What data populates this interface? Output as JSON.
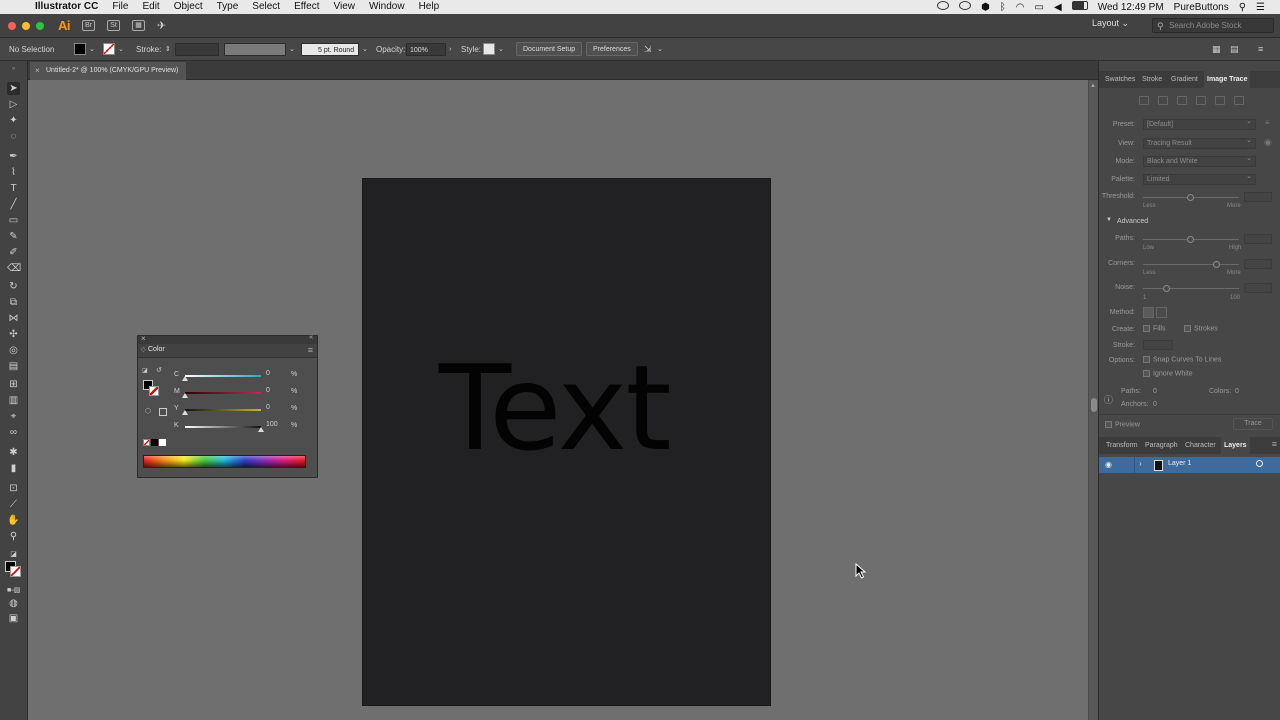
{
  "menubar": {
    "app_name": "Illustrator CC",
    "items": [
      "File",
      "Edit",
      "Object",
      "Type",
      "Select",
      "Effect",
      "View",
      "Window",
      "Help"
    ],
    "clock": "Wed 12:49 PM",
    "user": "PureButtons"
  },
  "appbar": {
    "logo": "Ai",
    "workspace": "Layout",
    "stock_placeholder": "Search Adobe Stock"
  },
  "control": {
    "selection": "No Selection",
    "stroke_label": "Stroke:",
    "brush": "5 pt. Round",
    "opacity_label": "Opacity:",
    "opacity_value": "100%",
    "style_label": "Style:",
    "document_setup": "Document Setup",
    "preferences": "Preferences"
  },
  "document": {
    "tab_title": "Untitled-2* @ 100% (CMYK/GPU Preview)",
    "artboard_text": "Text"
  },
  "color_panel": {
    "title": "Color",
    "channels": [
      {
        "label": "C",
        "value": "0",
        "unit": "%",
        "percent": 0,
        "track": "#2aa6c8"
      },
      {
        "label": "M",
        "value": "0",
        "unit": "%",
        "percent": 0,
        "track": "#c0285a"
      },
      {
        "label": "Y",
        "value": "0",
        "unit": "%",
        "percent": 0,
        "track": "#c8b82a"
      },
      {
        "label": "K",
        "value": "100",
        "unit": "%",
        "percent": 100,
        "track": "#cfcfcf"
      }
    ]
  },
  "right_panel": {
    "top_tabs": [
      "Swatches",
      "Stroke",
      "Gradient",
      "Image Trace"
    ],
    "image_trace": {
      "preset_label": "Preset:",
      "preset_value": "[Default]",
      "view_label": "View:",
      "view_value": "Tracing Result",
      "mode_label": "Mode:",
      "mode_value": "Black and White",
      "palette_label": "Palette:",
      "palette_value": "Limited",
      "threshold_label": "Threshold:",
      "less": "Less",
      "more": "More",
      "advanced_label": "Advanced",
      "paths_label": "Paths:",
      "low": "Low",
      "high": "High",
      "corners_label": "Corners:",
      "less2": "Less",
      "more2": "More",
      "noise_label": "Noise:",
      "noise_min": "1",
      "noise_max": "100",
      "method_label": "Method:",
      "create_label": "Create:",
      "fills": "Fills",
      "strokes": "Strokes",
      "stroke_label": "Stroke:",
      "options_label": "Options:",
      "snap": "Snap Curves To Lines",
      "ignore_white": "Ignore White",
      "paths_stat_label": "Paths:",
      "paths_stat": "0",
      "colors_stat_label": "Colors:",
      "colors_stat": "0",
      "anchors_stat_label": "Anchors:",
      "anchors_stat": "0",
      "preview": "Preview",
      "trace": "Trace"
    },
    "bottom_tabs": [
      "Transform",
      "Paragraph",
      "Character",
      "Layers"
    ],
    "layers": [
      {
        "name": "Layer 1"
      }
    ]
  }
}
